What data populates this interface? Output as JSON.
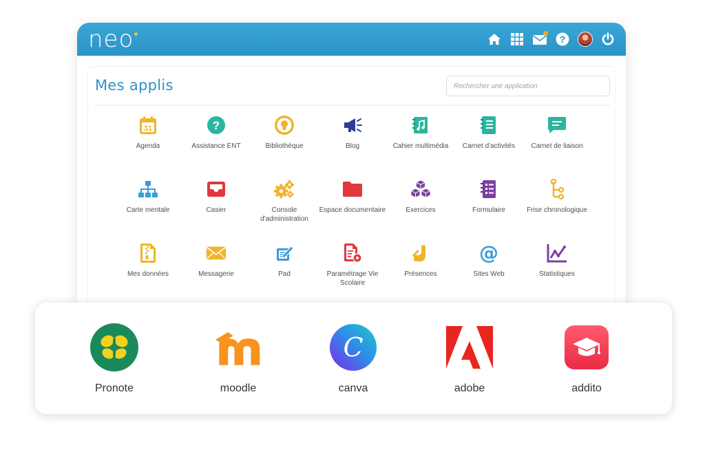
{
  "header": {
    "logo_text": "neo",
    "icons": [
      "home-icon",
      "apps-grid-icon",
      "messages-icon",
      "help-icon",
      "avatar",
      "power-icon"
    ]
  },
  "panel": {
    "title": "Mes applis",
    "search_placeholder": "Rechercher une application"
  },
  "apps": [
    {
      "label": "Agenda",
      "icon": "calendar-icon",
      "color": "#f0b429"
    },
    {
      "label": "Assistance ENT",
      "icon": "question-icon",
      "color": "#2bb5a0"
    },
    {
      "label": "Bibliothèque",
      "icon": "lightbulb-icon",
      "color": "#f0b429"
    },
    {
      "label": "Blog",
      "icon": "megaphone-icon",
      "color": "#2c3e99"
    },
    {
      "label": "Cahier multimédia",
      "icon": "music-book-icon",
      "color": "#2bb5a0"
    },
    {
      "label": "Carnet d'activités",
      "icon": "notebook-icon",
      "color": "#2bb5a0"
    },
    {
      "label": "Carnet de liaison",
      "icon": "chat-icon",
      "color": "#2bb5a0"
    },
    {
      "label": "Carte mentale",
      "icon": "sitemap-icon",
      "color": "#3a9bd9"
    },
    {
      "label": "Casier",
      "icon": "inbox-tray-icon",
      "color": "#e0383e"
    },
    {
      "label": "Console d'administration",
      "icon": "gears-icon",
      "color": "#f0b429"
    },
    {
      "label": "Espace documentaire",
      "icon": "folder-icon",
      "color": "#e0383e"
    },
    {
      "label": "Exercices",
      "icon": "cubes-icon",
      "color": "#7b3fa0"
    },
    {
      "label": "Formulaire",
      "icon": "checklist-icon",
      "color": "#7b3fa0"
    },
    {
      "label": "Frise chronologique",
      "icon": "timeline-icon",
      "color": "#f0b429"
    },
    {
      "label": "Mes données",
      "icon": "zip-file-icon",
      "color": "#f0b429"
    },
    {
      "label": "Messagerie",
      "icon": "envelope-icon",
      "color": "#f0b429"
    },
    {
      "label": "Pad",
      "icon": "pad-icon",
      "color": "#3a9bd9"
    },
    {
      "label": "Paramétrage Vie Scolaire",
      "icon": "settings-doc-icon",
      "color": "#e0383e"
    },
    {
      "label": "Présences",
      "icon": "raised-hand-icon",
      "color": "#f0b429"
    },
    {
      "label": "Sites Web",
      "icon": "at-sign-icon",
      "color": "#3a9bd9"
    },
    {
      "label": "Statistiques",
      "icon": "line-chart-icon",
      "color": "#7b3fa0"
    }
  ],
  "partners": [
    {
      "label": "Pronote",
      "icon": "pronote-logo"
    },
    {
      "label": "moodle",
      "icon": "moodle-logo"
    },
    {
      "label": "canva",
      "icon": "canva-logo"
    },
    {
      "label": "adobe",
      "icon": "adobe-logo"
    },
    {
      "label": "addito",
      "icon": "addito-logo"
    }
  ],
  "colors": {
    "topbar": "#2b94c8",
    "title": "#2b94c8"
  }
}
